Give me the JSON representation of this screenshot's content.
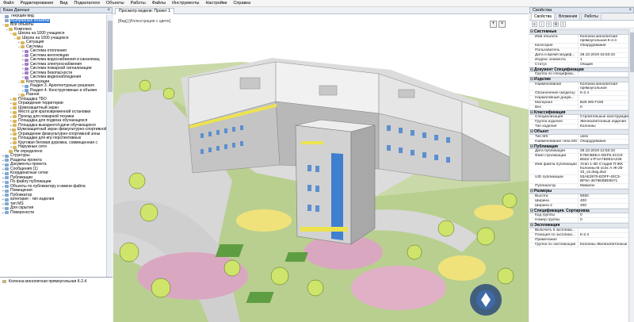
{
  "menu": [
    "Файл",
    "Редактирование",
    "Вид",
    "Подкаталоги",
    "Объекты",
    "Работы",
    "Файлы",
    "Инструменты",
    "Настройки",
    "Справка"
  ],
  "left_panel": {
    "title": "База Данных",
    "tree": [
      {
        "label": "Текущий вид",
        "indent": 0,
        "exp": "",
        "icon": "#8aa7c9"
      },
      {
        "label": "Выбранные объекты",
        "indent": 0,
        "exp": "",
        "icon": "#8aa7c9",
        "selected": true
      },
      {
        "label": "Все объекты",
        "indent": 0,
        "exp": "−",
        "icon": "#d9b65a"
      },
      {
        "label": "Комплекс",
        "indent": 1,
        "exp": "−",
        "icon": "#d9b65a"
      },
      {
        "label": "Школа на 1000 учащихся",
        "indent": 2,
        "exp": "−",
        "icon": "#d9b65a"
      },
      {
        "label": "Школа на 1000 учащихся",
        "indent": 3,
        "exp": "−",
        "icon": "#d9b65a"
      },
      {
        "label": "Ситуация",
        "indent": 4,
        "exp": "+",
        "icon": "#d9b65a"
      },
      {
        "label": "Системы",
        "indent": 4,
        "exp": "−",
        "icon": "#d9b65a"
      },
      {
        "label": "Система отопления",
        "indent": 5,
        "exp": "+",
        "icon": "#a57fc8"
      },
      {
        "label": "Система вентиляции",
        "indent": 5,
        "exp": "+",
        "icon": "#a57fc8"
      },
      {
        "label": "Система водоснабжения и канализац",
        "indent": 5,
        "exp": "+",
        "icon": "#a57fc8"
      },
      {
        "label": "Система электроснабжения",
        "indent": 5,
        "exp": "+",
        "icon": "#a57fc8"
      },
      {
        "label": "Система пожарной сигнализации",
        "indent": 5,
        "exp": "+",
        "icon": "#a57fc8"
      },
      {
        "label": "Система безопасности",
        "indent": 5,
        "exp": "+",
        "icon": "#a57fc8"
      },
      {
        "label": "Система видеонаблюдения",
        "indent": 5,
        "exp": "+",
        "icon": "#a57fc8"
      },
      {
        "label": "Конструкции",
        "indent": 4,
        "exp": "−",
        "icon": "#d9b65a"
      },
      {
        "label": "Раздел 3. Архитектурные решения",
        "indent": 5,
        "exp": "+",
        "icon": "#6fa3d8"
      },
      {
        "label": "Раздел 4. Конструктивные и объемн",
        "indent": 5,
        "exp": "+",
        "icon": "#6fa3d8"
      },
      {
        "label": "Разное",
        "indent": 4,
        "exp": "+",
        "icon": "#d9b65a"
      },
      {
        "label": "Площадка ТБО",
        "indent": 2,
        "exp": "+",
        "icon": "#d9b65a"
      },
      {
        "label": "Ограждения территории",
        "indent": 2,
        "exp": "+",
        "icon": "#d9b65a"
      },
      {
        "label": "Шумозащитный экран",
        "indent": 2,
        "exp": "+",
        "icon": "#d9b65a"
      },
      {
        "label": "Место для кратковременной остановки",
        "indent": 2,
        "exp": "+",
        "icon": "#d9b65a"
      },
      {
        "label": "Проезд для пожарной техники",
        "indent": 2,
        "exp": "+",
        "icon": "#d9b65a"
      },
      {
        "label": "Площадка для подвоза обучающихся",
        "indent": 2,
        "exp": "+",
        "icon": "#d9b65a"
      },
      {
        "label": "Площадка выездного/сдачи обучающихся",
        "indent": 2,
        "exp": "+",
        "icon": "#d9b65a"
      },
      {
        "label": "Шумозащитный экран физкультурно-спортивной зоны",
        "indent": 2,
        "exp": "+",
        "icon": "#d9b65a"
      },
      {
        "label": "Ограждение физкультурно-спортивной зоны",
        "indent": 2,
        "exp": "+",
        "icon": "#d9b65a"
      },
      {
        "label": "Площадки для игр перспективных",
        "indent": 2,
        "exp": "+",
        "icon": "#d9b65a"
      },
      {
        "label": "Круговая беговая дорожка, совмещенная с",
        "indent": 2,
        "exp": "+",
        "icon": "#d9b65a"
      },
      {
        "label": "Наружные сети",
        "indent": 2,
        "exp": "+",
        "icon": "#d9b65a"
      },
      {
        "label": "Не определено",
        "indent": 1,
        "exp": "",
        "icon": "#d9b65a"
      },
      {
        "label": "Структуры",
        "indent": 0,
        "exp": "+",
        "icon": "#7fa8d6"
      },
      {
        "label": "Разделы проекта",
        "indent": 0,
        "exp": "+",
        "icon": "#7fa8d6"
      },
      {
        "label": "Документы проекта",
        "indent": 0,
        "exp": "+",
        "icon": "#7fa8d6"
      },
      {
        "label": "Сообщения (1)",
        "indent": 0,
        "exp": "+",
        "icon": "#7fa8d6"
      },
      {
        "label": "Координатные сетки",
        "indent": 0,
        "exp": "+",
        "icon": "#7fa8d6"
      },
      {
        "label": "Публикации",
        "indent": 0,
        "exp": "+",
        "icon": "#7fa8d6"
      },
      {
        "label": "По файлу публикации",
        "indent": 0,
        "exp": "+",
        "icon": "#7fa8d6"
      },
      {
        "label": "Объекты по публикатору и имени файла",
        "indent": 0,
        "exp": "+",
        "icon": "#7fa8d6"
      },
      {
        "label": "Помещения",
        "indent": 0,
        "exp": "+",
        "icon": "#7fa8d6"
      },
      {
        "label": "Публикатор",
        "indent": 0,
        "exp": "+",
        "icon": "#7fa8d6"
      },
      {
        "label": "категория - тип изделия",
        "indent": 0,
        "exp": "+",
        "icon": "#7fa8d6"
      },
      {
        "label": "тип MS",
        "indent": 0,
        "exp": "+",
        "icon": "#7fa8d6"
      },
      {
        "label": "Для скрытия",
        "indent": 0,
        "exp": "+",
        "icon": "#7fa8d6"
      },
      {
        "label": "Поверхности",
        "indent": 0,
        "exp": "+",
        "icon": "#7fa8d6"
      }
    ],
    "bottom_item": "Колонна монолитная прямоугольная К-2.4"
  },
  "viewport": {
    "tab": "Просмотр модели: Проект 1",
    "caption": "[Вид] [Иллюстрация с цвете]"
  },
  "right_panel": {
    "title": "Свойства",
    "tabs": [
      "Свойства",
      "Вложения",
      "Работы"
    ],
    "sections": [
      {
        "title": "Системные",
        "props": [
          [
            "Имя объекта",
            "Колонна монолитная прямоугольная К-2.4"
          ],
          [
            "Категория",
            "Оборудование"
          ],
          [
            "Пользователь",
            ""
          ],
          [
            "Дата и время модиф...",
            "28.10.2019 15:53:10"
          ],
          [
            "Индекс элемента",
            "1"
          ],
          [
            "Статус",
            "Общий"
          ]
        ]
      },
      {
        "title": "Документ Спецификации",
        "props": [
          [
            "Группа по специфика...",
            ""
          ]
        ]
      },
      {
        "title": "Изделие",
        "props": [
          [
            "Наименование",
            "Колонна монолитная прямоугольная"
          ],
          [
            "Обозначение (модель)",
            "К-2.4"
          ],
          [
            "Нормативный докум...",
            ""
          ],
          [
            "Материал",
            "B25 W6 F150"
          ],
          [
            "Вес",
            "0"
          ]
        ]
      },
      {
        "title": "Классификация",
        "props": [
          [
            "Специализация",
            "Строительные конструкции"
          ],
          [
            "Группа изделия",
            "Железобетонные изделия"
          ],
          [
            "Тип изделия",
            "Колонны"
          ]
        ]
      },
      {
        "title": "Объект",
        "props": [
          [
            "Тип MS",
            "unitx"
          ],
          [
            "Наименование типа MS",
            "Оборудование"
          ]
        ]
      },
      {
        "title": "Публикация",
        "props": [
          [
            "Дата публикации",
            "28.10.2019 12:53:10"
          ],
          [
            "Файл публикации",
            "E7BCBEEA-DEF6-4CC8-B502-17F4A7B0E2A236"
          ],
          [
            "Имя файла публикации",
            "Этап 1-3D Стадия П-ЖК Колонны-В осях А-Ж-25-33_v2.dwg.dwz"
          ],
          [
            "UID публикации",
            "53AE2870-EDFF-40C3-BF9A-3678EB8E9571"
          ],
          [
            "Публикатор",
            "Makarov"
          ]
        ]
      },
      {
        "title": "Размеры",
        "props": [
          [
            "Высота",
            "5050"
          ],
          [
            "Ширина",
            "400"
          ],
          [
            "Ширина 2",
            "400"
          ]
        ]
      },
      {
        "title": "Спецификация. Сортировка",
        "props": [
          [
            "Код группы",
            "0"
          ],
          [
            "Номер группы",
            "0"
          ]
        ]
      },
      {
        "title": "Экспликация",
        "props": [
          [
            "Включить в эксплика...",
            ""
          ],
          [
            "Позиция по эксплика...",
            "К-2.4"
          ],
          [
            "Примечание",
            ""
          ],
          [
            "Группа по экспликации",
            "Колонны Железобетонные"
          ]
        ]
      }
    ]
  }
}
